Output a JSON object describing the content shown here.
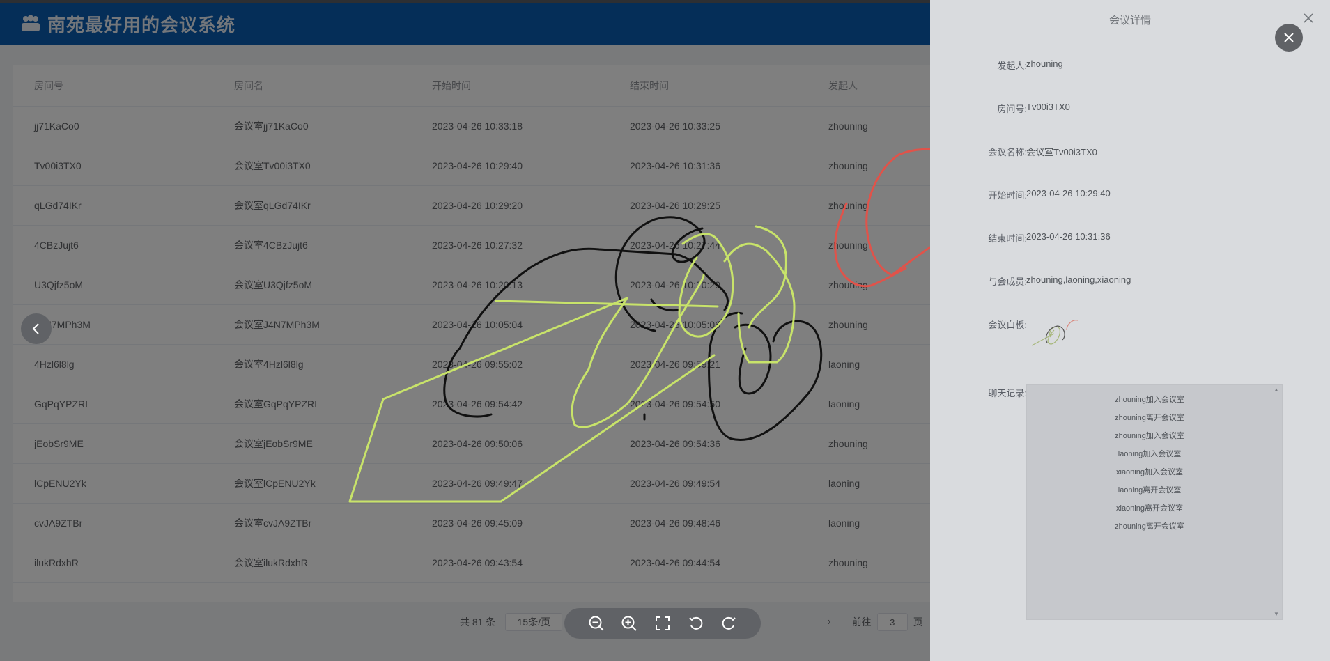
{
  "app": {
    "title": "南苑最好用的会议系统"
  },
  "table": {
    "headers": {
      "room_id": "房间号",
      "room_name": "房间名",
      "start": "开始时间",
      "end": "结束时间",
      "initiator": "发起人"
    },
    "rows": [
      [
        "jj71KaCo0",
        "会议室jj71KaCo0",
        "2023-04-26 10:33:18",
        "2023-04-26 10:33:25",
        "zhouning"
      ],
      [
        "Tv00i3TX0",
        "会议室Tv00i3TX0",
        "2023-04-26 10:29:40",
        "2023-04-26 10:31:36",
        "zhouning"
      ],
      [
        "qLGd74IKr",
        "会议室qLGd74IKr",
        "2023-04-26 10:29:20",
        "2023-04-26 10:29:25",
        "zhouning"
      ],
      [
        "4CBzJujt6",
        "会议室4CBzJujt6",
        "2023-04-26 10:27:32",
        "2023-04-26 10:27:44",
        "zhouning"
      ],
      [
        "U3Qjfz5oM",
        "会议室U3Qjfz5oM",
        "2023-04-26 10:20:13",
        "2023-04-26 10:20:29",
        "zhouning"
      ],
      [
        "J4N7MPh3M",
        "会议室J4N7MPh3M",
        "2023-04-26 10:05:04",
        "2023-04-26 10:05:06",
        "zhouning"
      ],
      [
        "4Hzl6l8lg",
        "会议室4Hzl6l8lg",
        "2023-04-26 09:55:02",
        "2023-04-26 09:59:21",
        "laoning"
      ],
      [
        "GqPqYPZRI",
        "会议室GqPqYPZRI",
        "2023-04-26 09:54:42",
        "2023-04-26 09:54:50",
        "laoning"
      ],
      [
        "jEobSr9ME",
        "会议室jEobSr9ME",
        "2023-04-26 09:50:06",
        "2023-04-26 09:54:36",
        "zhouning"
      ],
      [
        "lCpENU2Yk",
        "会议室lCpENU2Yk",
        "2023-04-26 09:49:47",
        "2023-04-26 09:49:54",
        "laoning"
      ],
      [
        "cvJA9ZTBr",
        "会议室cvJA9ZTBr",
        "2023-04-26 09:45:09",
        "2023-04-26 09:48:46",
        "laoning"
      ],
      [
        "ilukRdxhR",
        "会议室ilukRdxhR",
        "2023-04-26 09:43:54",
        "2023-04-26 09:44:54",
        "zhouning"
      ]
    ]
  },
  "pagination": {
    "total": "共 81 条",
    "page_size": "15条/页",
    "goto_label": "前往",
    "goto_value": "3",
    "page_suffix": "页"
  },
  "drawer": {
    "title": "会议详情",
    "initiator_label": "发起人:",
    "initiator": "zhouning",
    "room_label": "房间号:",
    "room": "Tv00i3TX0",
    "name_label": "会议名称:",
    "name": "会议室Tv00i3TX0",
    "start_label": "开始时间:",
    "start": "2023-04-26 10:29:40",
    "end_label": "结束时间:",
    "end": "2023-04-26 10:31:36",
    "members_label": "与会成员:",
    "members": "zhouning,laoning,xiaoning",
    "whiteboard_label": "会议白板:",
    "chat_label": "聊天记录:",
    "chat": [
      "zhouning加入会议室",
      "zhouning离开会议室",
      "zhouning加入会议室",
      "laoning加入会议室",
      "xiaoning加入会议室",
      "laoning离开会议室",
      "xiaoning离开会议室",
      "zhouning离开会议室"
    ]
  },
  "icons": {
    "logo": "people-icon",
    "prev": "chevron-left-icon",
    "next": "chevron-right-icon",
    "close": "close-icon",
    "zoom_out": "zoom-out-icon",
    "zoom_in": "zoom-in-icon",
    "fullscreen": "fullscreen-icon",
    "rotate_left": "rotate-left-icon",
    "rotate_right": "rotate-right-icon"
  },
  "colors": {
    "topbar": "#0b5cb0",
    "stroke_black": "#111111",
    "stroke_green": "#c8e36a",
    "stroke_red": "#e0534a"
  }
}
